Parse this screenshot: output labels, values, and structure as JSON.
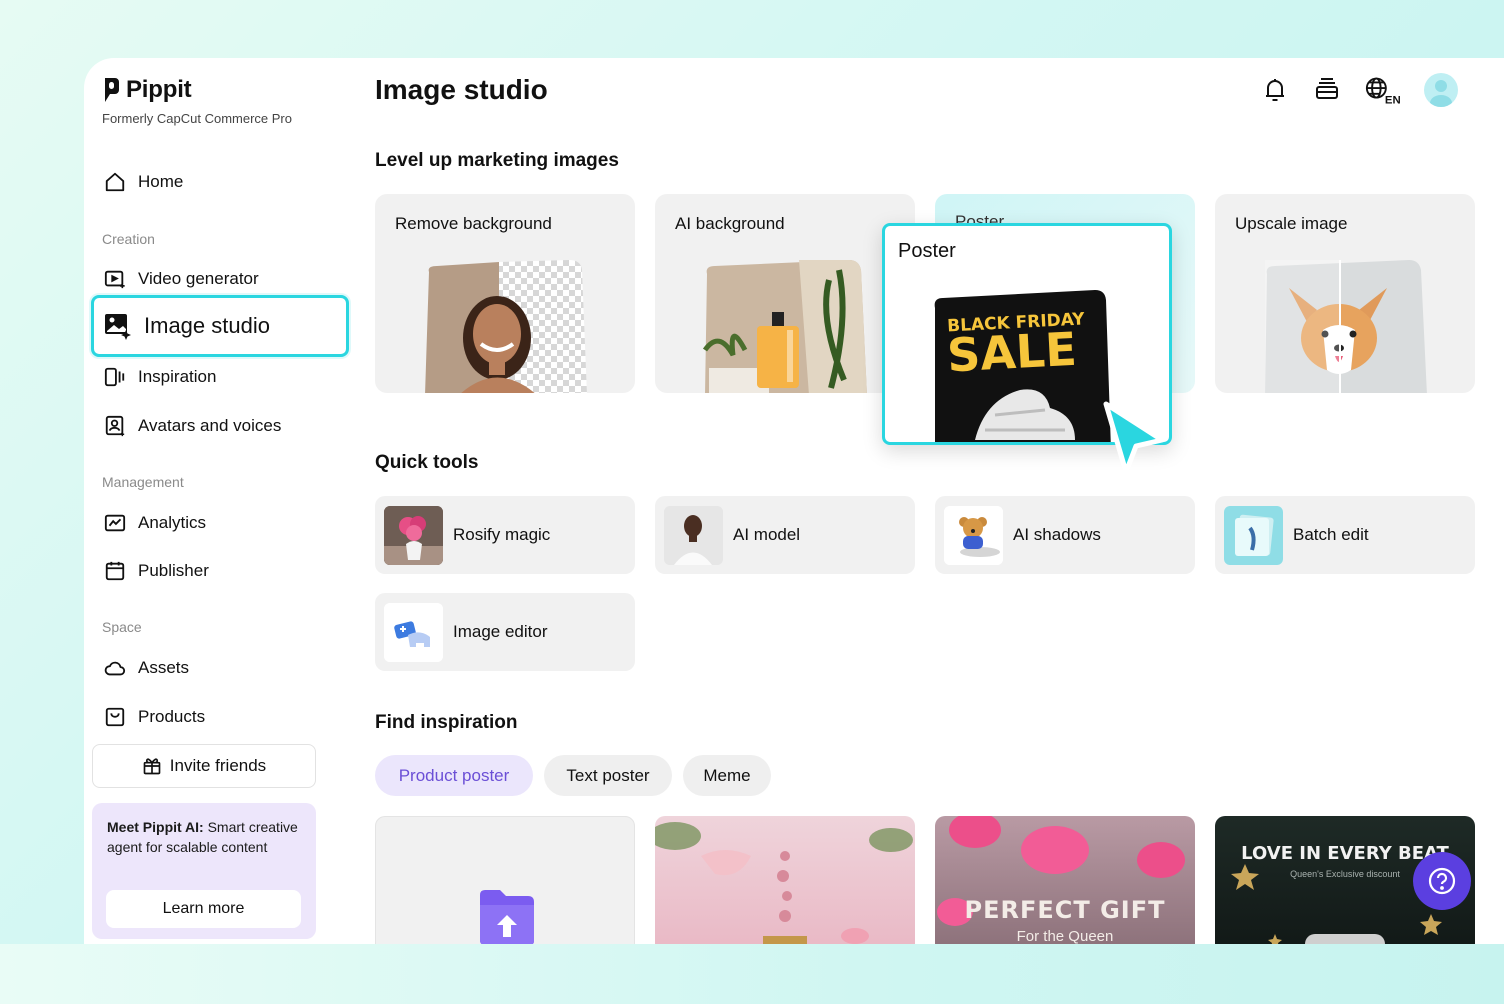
{
  "app": {
    "name": "Pippit",
    "subtitle": "Formerly CapCut Commerce Pro"
  },
  "sidebar": {
    "home": "Home",
    "sections": {
      "creation": "Creation",
      "management": "Management",
      "space": "Space"
    },
    "items": {
      "video_generator": "Video generator",
      "image_studio": "Image studio",
      "inspiration": "Inspiration",
      "avatars": "Avatars and voices",
      "analytics": "Analytics",
      "publisher": "Publisher",
      "assets": "Assets",
      "products": "Products"
    },
    "invite": "Invite friends",
    "promo": {
      "bold": "Meet Pippit AI:",
      "text": " Smart creative agent for scalable content",
      "button": "Learn more"
    }
  },
  "header": {
    "title": "Image studio",
    "lang": "EN"
  },
  "marketing": {
    "title": "Level up marketing images",
    "cards": [
      "Remove background",
      "AI background",
      "Poster",
      "Upscale image"
    ],
    "poster_popup": "Poster",
    "poster_text": {
      "line1": "BLACK FRIDAY",
      "line2": "SALE"
    }
  },
  "quick_tools": {
    "title": "Quick tools",
    "tools": [
      "Rosify magic",
      "AI model",
      "AI shadows",
      "Batch edit",
      "Image editor"
    ]
  },
  "inspiration": {
    "title": "Find inspiration",
    "chips": [
      "Product poster",
      "Text poster",
      "Meme"
    ],
    "cards": [
      {
        "title": "",
        "subtitle": ""
      },
      {
        "title": "",
        "subtitle": ""
      },
      {
        "title": "PERFECT GIFT",
        "subtitle": "For the Queen"
      },
      {
        "title": "LOVE IN EVERY BEAT",
        "subtitle": "Queen's Exclusive discount"
      }
    ]
  },
  "colors": {
    "accent_cyan": "#2ad6e0",
    "accent_purple": "#5b3fe0",
    "chip_active_text": "#6b4fd6"
  }
}
